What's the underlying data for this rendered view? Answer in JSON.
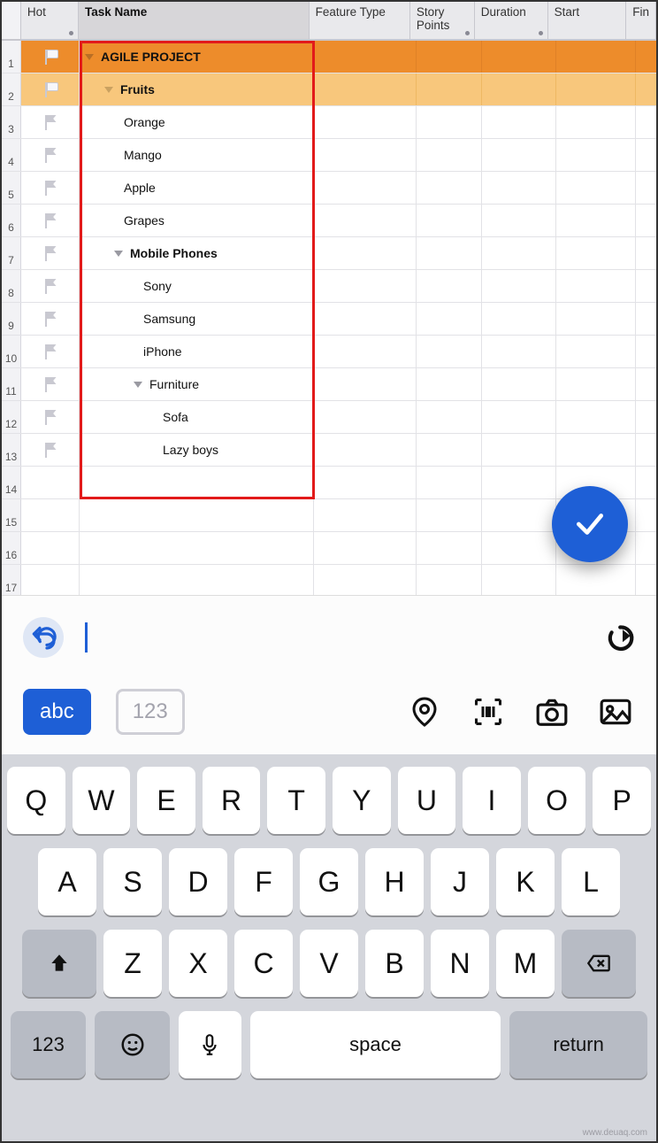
{
  "columns": {
    "hot": "Hot",
    "task_name": "Task Name",
    "feature_type": "Feature Type",
    "story_points": "Story Points",
    "duration": "Duration",
    "start": "Start",
    "finish": "Fin"
  },
  "col_widths": {
    "gutter": 22,
    "flag": 66,
    "name": 265,
    "feature_type": 116,
    "story_points": 74,
    "duration": 84,
    "start": 90,
    "finish": 35
  },
  "rows": [
    {
      "n": 1,
      "flag": "white",
      "level": 1,
      "caret": true,
      "bold": true,
      "style": "proj",
      "label": "AGILE PROJECT"
    },
    {
      "n": 2,
      "flag": "white",
      "level": 2,
      "caret": true,
      "bold": true,
      "style": "sub",
      "label": "Fruits"
    },
    {
      "n": 3,
      "flag": "grey",
      "level": 3,
      "caret": false,
      "bold": false,
      "style": "",
      "label": "Orange"
    },
    {
      "n": 4,
      "flag": "grey",
      "level": 3,
      "caret": false,
      "bold": false,
      "style": "",
      "label": "Mango"
    },
    {
      "n": 5,
      "flag": "grey",
      "level": 3,
      "caret": false,
      "bold": false,
      "style": "",
      "label": "Apple"
    },
    {
      "n": 6,
      "flag": "grey",
      "level": 3,
      "caret": false,
      "bold": false,
      "style": "",
      "label": "Grapes"
    },
    {
      "n": 7,
      "flag": "grey",
      "level": 3,
      "caret": true,
      "bold": true,
      "style": "",
      "label": "Mobile Phones",
      "indentOverride": 2.5
    },
    {
      "n": 8,
      "flag": "grey",
      "level": 4,
      "caret": false,
      "bold": false,
      "style": "",
      "label": "Sony"
    },
    {
      "n": 9,
      "flag": "grey",
      "level": 4,
      "caret": false,
      "bold": false,
      "style": "",
      "label": "Samsung"
    },
    {
      "n": 10,
      "flag": "grey",
      "level": 4,
      "caret": false,
      "bold": false,
      "style": "",
      "label": "iPhone"
    },
    {
      "n": 11,
      "flag": "grey",
      "level": 4,
      "caret": true,
      "bold": false,
      "style": "",
      "label": "Furniture",
      "indentOverride": 3.5
    },
    {
      "n": 12,
      "flag": "grey",
      "level": 5,
      "caret": false,
      "bold": false,
      "style": "",
      "label": "Sofa"
    },
    {
      "n": 13,
      "flag": "grey",
      "level": 5,
      "caret": false,
      "bold": false,
      "style": "",
      "label": "Lazy boys"
    },
    {
      "n": 14,
      "flag": "",
      "level": 0,
      "caret": false,
      "bold": false,
      "style": "",
      "label": "",
      "editing": true
    },
    {
      "n": 15,
      "flag": "",
      "level": 0,
      "caret": false,
      "bold": false,
      "style": "",
      "label": ""
    },
    {
      "n": 16,
      "flag": "",
      "level": 0,
      "caret": false,
      "bold": false,
      "style": "",
      "label": ""
    },
    {
      "n": 17,
      "flag": "",
      "level": 0,
      "caret": false,
      "bold": false,
      "style": "",
      "label": ""
    }
  ],
  "toolbar": {
    "mode_abc": "abc",
    "mode_123": "123"
  },
  "keyboard": {
    "row1": [
      "Q",
      "W",
      "E",
      "R",
      "T",
      "Y",
      "U",
      "I",
      "O",
      "P"
    ],
    "row2": [
      "A",
      "S",
      "D",
      "F",
      "G",
      "H",
      "J",
      "K",
      "L"
    ],
    "row3": [
      "Z",
      "X",
      "C",
      "V",
      "B",
      "N",
      "M"
    ],
    "mode_key": "123",
    "space": "space",
    "return": "return"
  },
  "watermark": "www.deuaq.com"
}
